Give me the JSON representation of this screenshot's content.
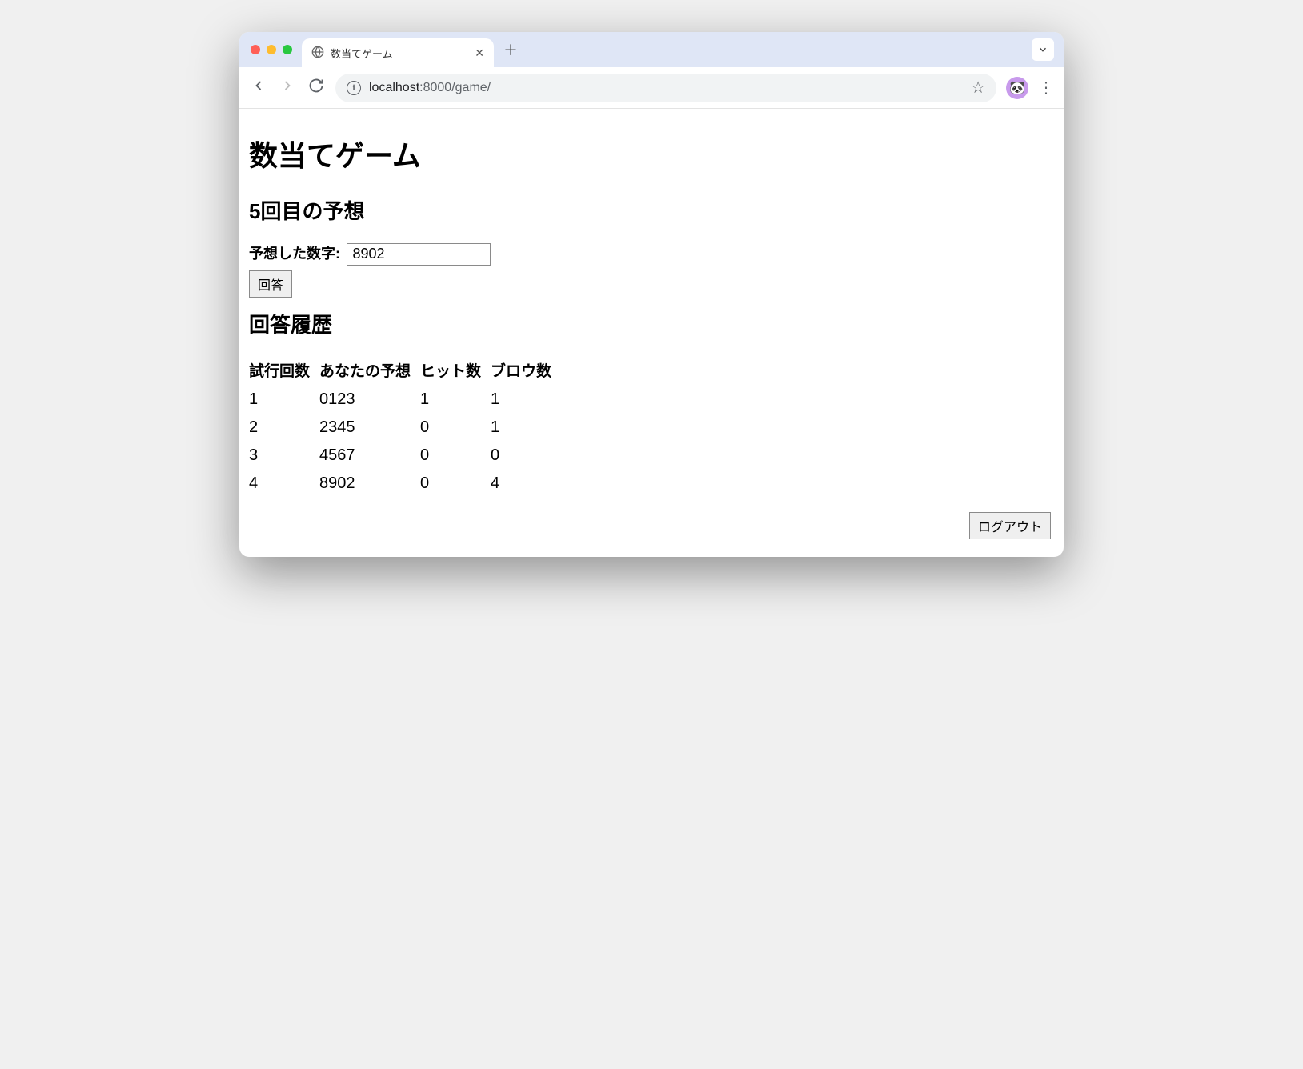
{
  "browser": {
    "tab_title": "数当てゲーム",
    "url_host": "localhost",
    "url_port_prefix": ":",
    "url_path": "8000/game/",
    "avatar_emoji": "🐼"
  },
  "page": {
    "title": "数当てゲーム",
    "guess_heading": "5回目の予想",
    "form": {
      "label": "予想した数字:",
      "value": "8902",
      "submit_label": "回答"
    },
    "history_heading": "回答履歴",
    "history_headers": {
      "trial": "試行回数",
      "guess": "あなたの予想",
      "hits": "ヒット数",
      "blows": "ブロウ数"
    },
    "history": [
      {
        "trial": "1",
        "guess": "0123",
        "hits": "1",
        "blows": "1"
      },
      {
        "trial": "2",
        "guess": "2345",
        "hits": "0",
        "blows": "1"
      },
      {
        "trial": "3",
        "guess": "4567",
        "hits": "0",
        "blows": "0"
      },
      {
        "trial": "4",
        "guess": "8902",
        "hits": "0",
        "blows": "4"
      }
    ],
    "logout_label": "ログアウト"
  }
}
